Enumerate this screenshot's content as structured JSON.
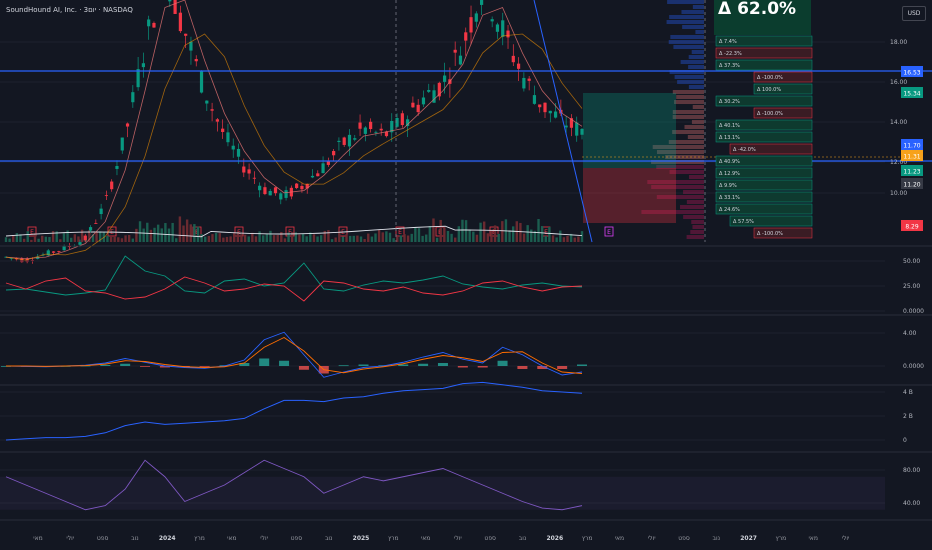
{
  "header": {
    "symbol_title": "SoundHound AI, Inc. · 3יום · NASDAQ",
    "currency": "USD"
  },
  "price_pane": {
    "axis_ticks": [
      "18.00",
      "16.00",
      "14.00",
      "12.00",
      "10.00"
    ],
    "horizontal_line_labels": [
      "16.53",
      "11.70"
    ],
    "badges": [
      {
        "text": "16.53",
        "color": "#2962ff"
      },
      {
        "text": "15.34",
        "color": "#089981"
      },
      {
        "text": "11.70",
        "color": "#2962ff"
      },
      {
        "text": "11.31",
        "color": "#f7a21b"
      },
      {
        "text": "11.23",
        "color": "#089981"
      },
      {
        "text": "11.20",
        "color": "#363a45"
      },
      {
        "text": "8.29",
        "color": "#f23645"
      }
    ],
    "big_stat": "Δ 62.0%",
    "stat_boxes": [
      "Δ 7.4%",
      "Δ -22.3%",
      "Δ 37.3%",
      "Δ -100.0%",
      "Δ 100.0%",
      "Δ 30.2%",
      "Δ -100.0%",
      "Δ 40.1%",
      "Δ 13.1%",
      "Δ -42.0%",
      "Δ 40.9%",
      "Δ 12.9%",
      "Δ 9.9%",
      "Δ 33.1%",
      "Δ 24.6%",
      "Δ 57.5%",
      "Δ -100.0%"
    ],
    "earnings_label": "E"
  },
  "chart_data": [
    {
      "type": "line",
      "title": "",
      "series": [
        {
          "values": [
            3,
            2.8,
            3.2,
            3.6,
            4.2,
            6.5,
            11,
            17,
            22,
            18,
            14,
            11,
            9,
            7.5,
            7,
            7.8,
            9,
            10.5,
            11.5,
            11,
            12,
            13.5,
            14.5,
            17,
            21,
            18,
            15,
            13,
            12,
            11.3
          ]
        }
      ],
      "y_ticks": [
        18,
        16,
        14,
        12,
        10
      ],
      "x_ticks": [
        "מאי",
        "יולי",
        "ספט",
        "נוב",
        "2024",
        "מרץ",
        "מאי",
        "יולי",
        "ספט",
        "נוב",
        "2025",
        "מרץ",
        "מאי",
        "יולי",
        "ספט",
        "נוב",
        "2026",
        "מרץ",
        "מאי",
        "יולי",
        "ספט",
        "נוב",
        "2027",
        "מרץ",
        "מאי",
        "יולי"
      ],
      "horizontal_lines": [
        16.53,
        11.7
      ],
      "last_value": 11.31
    },
    {
      "type": "line",
      "series": [
        {
          "values": [
            21,
            22,
            19,
            16,
            18,
            21,
            55,
            40,
            35,
            20,
            18,
            30,
            32,
            25,
            28,
            48,
            22,
            20,
            26,
            30,
            28,
            31,
            35,
            27,
            24,
            22,
            26,
            28,
            25,
            24
          ],
          "color": "#089981"
        },
        {
          "values": [
            28,
            22,
            30,
            33,
            20,
            18,
            12,
            14,
            22,
            34,
            28,
            20,
            22,
            27,
            25,
            10,
            30,
            28,
            22,
            20,
            24,
            18,
            16,
            20,
            28,
            30,
            24,
            20,
            24,
            25
          ],
          "color": "#f23645"
        }
      ],
      "y_ticks": [
        "50.00",
        "25.00",
        "0.0000"
      ]
    },
    {
      "type": "bar",
      "series": [
        {
          "name": "MACD",
          "values": [
            0,
            -0.05,
            -0.1,
            0,
            0.1,
            0.4,
            1,
            0.5,
            0,
            -0.2,
            -0.3,
            0,
            0.8,
            3.5,
            4.5,
            1.5,
            -1.5,
            -0.8,
            -0.2,
            0,
            0.5,
            1.2,
            1.8,
            0.9,
            0.4,
            2.5,
            1.5,
            0,
            -1.2,
            -0.8
          ],
          "color": "#2962ff"
        },
        {
          "name": "Signal",
          "values": [
            0,
            0,
            -0.05,
            0,
            0.05,
            0.25,
            0.7,
            0.6,
            0.2,
            -0.1,
            -0.2,
            -0.1,
            0.4,
            2.5,
            3.8,
            2,
            -0.5,
            -0.9,
            -0.4,
            -0.1,
            0.3,
            0.9,
            1.4,
            1.1,
            0.6,
            1.8,
            1.9,
            0.4,
            -0.8,
            -1
          ]
        }
      ],
      "y_ticks": [
        "4.00",
        "0.0000"
      ]
    },
    {
      "type": "area",
      "series": [
        {
          "values": [
            0,
            0.1,
            0.2,
            0.2,
            0.3,
            0.6,
            1.2,
            1.5,
            1.3,
            1.4,
            1.5,
            1.6,
            1.8,
            2.6,
            3.3,
            3.3,
            3.2,
            3.5,
            3.6,
            3.9,
            4.1,
            4.2,
            4.3,
            4.7,
            4.8,
            4.6,
            4.4,
            4.1,
            4,
            3.9
          ],
          "color": "#2962ff"
        }
      ],
      "y_ticks": [
        "4 B",
        "2 B",
        "0"
      ]
    },
    {
      "type": "line",
      "series": [
        {
          "values": [
            70,
            60,
            50,
            40,
            30,
            35,
            55,
            90,
            70,
            40,
            50,
            60,
            75,
            90,
            80,
            70,
            50,
            60,
            70,
            65,
            70,
            75,
            80,
            70,
            60,
            50,
            40,
            32,
            30,
            35
          ],
          "color": "#7e57c2"
        }
      ],
      "y_ticks": [
        "80.00",
        "40.00"
      ],
      "bands": [
        30,
        70
      ]
    }
  ]
}
